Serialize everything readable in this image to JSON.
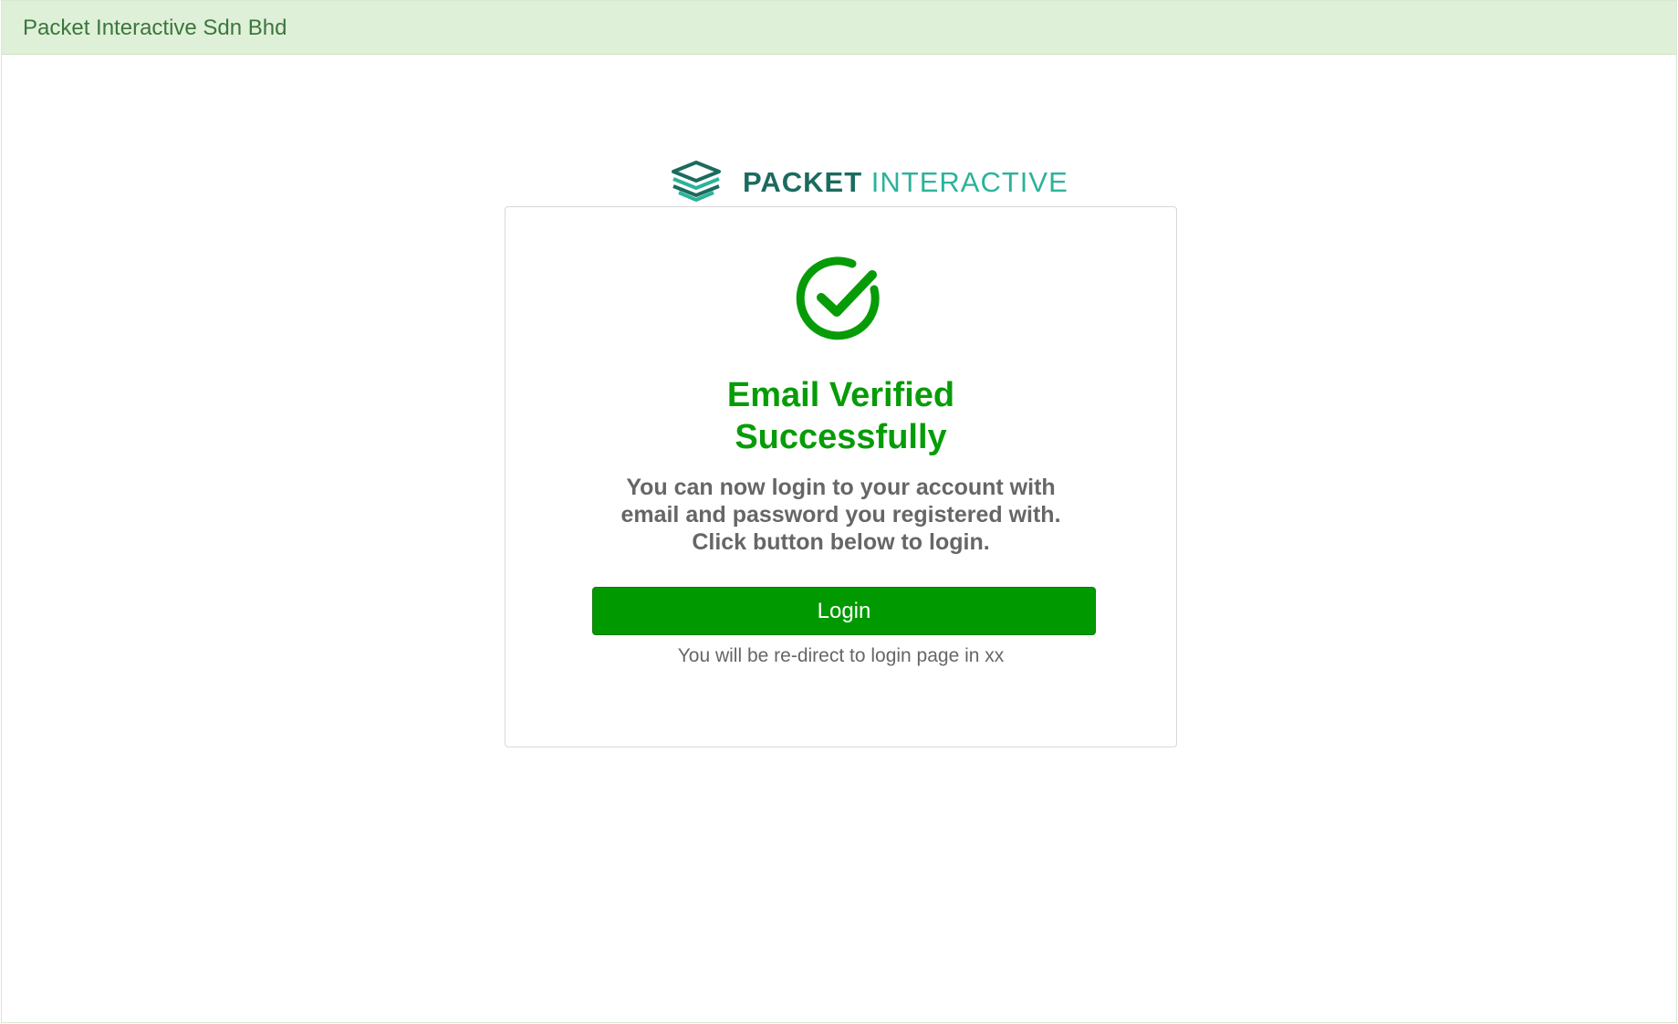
{
  "header": {
    "title": "Packet Interactive Sdn Bhd"
  },
  "logo": {
    "icon": "stacked-layers-icon",
    "word_strong": "PACKET",
    "word_light": "INTERACTIVE"
  },
  "status": {
    "icon": "check-circle-icon",
    "heading_line1": "Email Verified",
    "heading_line2": "Successfully",
    "message_line1": "You can now login to your account with",
    "message_line2": "email and password you registered with.",
    "message_line3": "Click button below to login."
  },
  "actions": {
    "login_label": "Login"
  },
  "redirect": {
    "text": "You will be re-direct to login page in xx"
  },
  "colors": {
    "header_bg": "#dff0d8",
    "header_text": "#3c763d",
    "success_green": "#079c07",
    "button_green": "#009a00",
    "logo_dark": "#1b6b5e",
    "logo_light": "#2bb39a"
  }
}
